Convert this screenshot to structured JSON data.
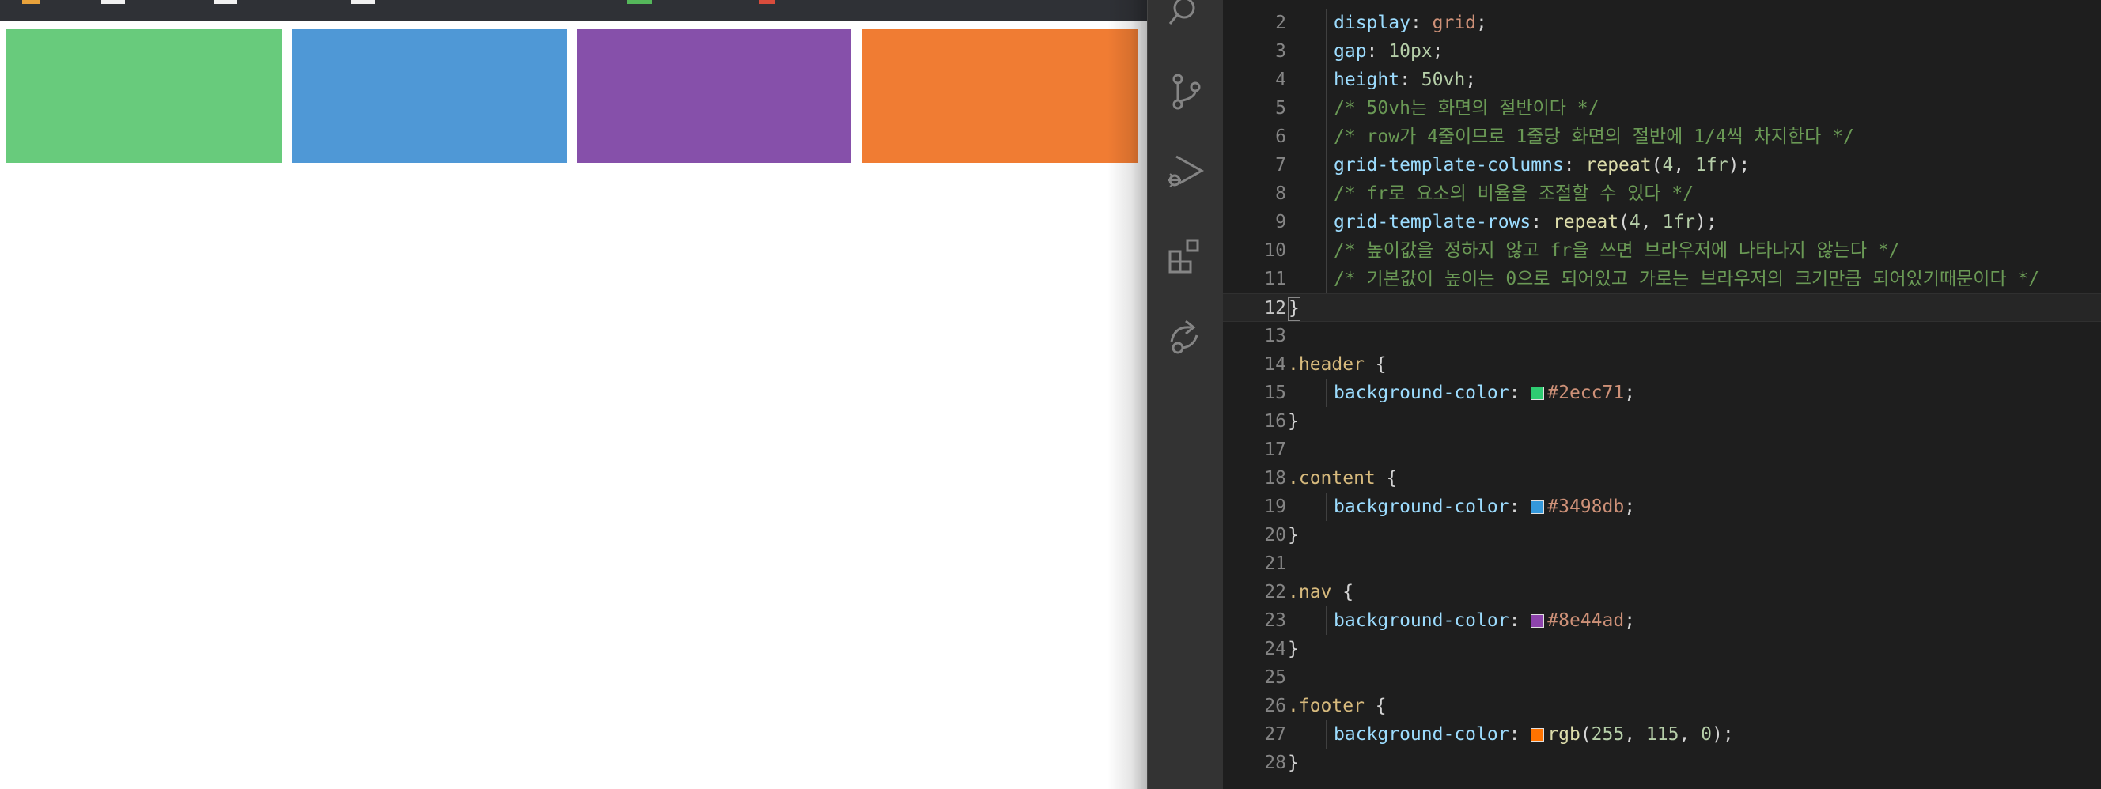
{
  "browser": {
    "bookmark_colors": [
      "#e8a23b",
      "#f1f1f1",
      "#f1f1f1",
      "#f1f1f1",
      "#55b75b",
      "#d94c3c"
    ],
    "grid_boxes": [
      {
        "name": "header",
        "color": "#68cb7c"
      },
      {
        "name": "content",
        "color": "#4f98d6"
      },
      {
        "name": "nav",
        "color": "#8650aa"
      },
      {
        "name": "footer",
        "color": "#f07c33"
      }
    ]
  },
  "activity_bar": {
    "icons": [
      "search-icon",
      "source-control-icon",
      "run-debug-icon",
      "extensions-icon",
      "remote-icon"
    ]
  },
  "editor": {
    "lines": [
      {
        "n": "2",
        "tokens": [
          [
            "prop",
            "display"
          ],
          [
            "pun",
            ": "
          ],
          [
            "val",
            "grid"
          ],
          [
            "pun",
            ";"
          ]
        ]
      },
      {
        "n": "3",
        "tokens": [
          [
            "prop",
            "gap"
          ],
          [
            "pun",
            ": "
          ],
          [
            "num",
            "10px"
          ],
          [
            "pun",
            ";"
          ]
        ]
      },
      {
        "n": "4",
        "tokens": [
          [
            "prop",
            "height"
          ],
          [
            "pun",
            ": "
          ],
          [
            "num",
            "50vh"
          ],
          [
            "pun",
            ";"
          ]
        ]
      },
      {
        "n": "5",
        "tokens": [
          [
            "cm",
            "/* 50vh는 화면의 절반이다 */"
          ]
        ]
      },
      {
        "n": "6",
        "tokens": [
          [
            "cm",
            "/* row가 4줄이므로 1줄당 화면의 절반에 1/4씩 차지한다 */"
          ]
        ]
      },
      {
        "n": "7",
        "tokens": [
          [
            "prop",
            "grid-template-columns"
          ],
          [
            "pun",
            ": "
          ],
          [
            "fn",
            "repeat"
          ],
          [
            "pun",
            "("
          ],
          [
            "num",
            "4"
          ],
          [
            "pun",
            ", "
          ],
          [
            "num",
            "1fr"
          ],
          [
            "pun",
            ");"
          ]
        ]
      },
      {
        "n": "8",
        "tokens": [
          [
            "cm",
            "/* fr로 요소의 비율을 조절할 수 있다 */"
          ]
        ]
      },
      {
        "n": "9",
        "tokens": [
          [
            "prop",
            "grid-template-rows"
          ],
          [
            "pun",
            ": "
          ],
          [
            "fn",
            "repeat"
          ],
          [
            "pun",
            "("
          ],
          [
            "num",
            "4"
          ],
          [
            "pun",
            ", "
          ],
          [
            "num",
            "1fr"
          ],
          [
            "pun",
            ");"
          ]
        ]
      },
      {
        "n": "10",
        "tokens": [
          [
            "cm",
            "/* 높이값을 정하지 않고 fr을 쓰면 브라우저에 나타나지 않는다 */"
          ]
        ]
      },
      {
        "n": "11",
        "tokens": [
          [
            "cm",
            "/* 기본값이 높이는 0으로 되어있고 가로는 브라우저의 크기만큼 되어있기때문이다 */"
          ]
        ]
      },
      {
        "n": "12",
        "tokens": [
          [
            "pun",
            "}"
          ]
        ],
        "current": true,
        "outdent": true
      },
      {
        "n": "13",
        "tokens": [],
        "outdent": true
      },
      {
        "n": "14",
        "tokens": [
          [
            "sel",
            ".header"
          ],
          [
            "pun",
            " {"
          ]
        ],
        "outdent": true
      },
      {
        "n": "15",
        "tokens": [
          [
            "prop",
            "background-color"
          ],
          [
            "pun",
            ": "
          ],
          [
            "swatch",
            "#2ecc71"
          ],
          [
            "val",
            "#2ecc71"
          ],
          [
            "pun",
            ";"
          ]
        ]
      },
      {
        "n": "16",
        "tokens": [
          [
            "pun",
            "}"
          ]
        ],
        "outdent": true
      },
      {
        "n": "17",
        "tokens": [],
        "outdent": true
      },
      {
        "n": "18",
        "tokens": [
          [
            "sel",
            ".content"
          ],
          [
            "pun",
            " {"
          ]
        ],
        "outdent": true
      },
      {
        "n": "19",
        "tokens": [
          [
            "prop",
            "background-color"
          ],
          [
            "pun",
            ": "
          ],
          [
            "swatch",
            "#3498db"
          ],
          [
            "val",
            "#3498db"
          ],
          [
            "pun",
            ";"
          ]
        ]
      },
      {
        "n": "20",
        "tokens": [
          [
            "pun",
            "}"
          ]
        ],
        "outdent": true
      },
      {
        "n": "21",
        "tokens": [],
        "outdent": true
      },
      {
        "n": "22",
        "tokens": [
          [
            "sel",
            ".nav"
          ],
          [
            "pun",
            " {"
          ]
        ],
        "outdent": true
      },
      {
        "n": "23",
        "tokens": [
          [
            "prop",
            "background-color"
          ],
          [
            "pun",
            ": "
          ],
          [
            "swatch",
            "#8e44ad"
          ],
          [
            "val",
            "#8e44ad"
          ],
          [
            "pun",
            ";"
          ]
        ]
      },
      {
        "n": "24",
        "tokens": [
          [
            "pun",
            "}"
          ]
        ],
        "outdent": true
      },
      {
        "n": "25",
        "tokens": [],
        "outdent": true
      },
      {
        "n": "26",
        "tokens": [
          [
            "sel",
            ".footer"
          ],
          [
            "pun",
            " {"
          ]
        ],
        "outdent": true
      },
      {
        "n": "27",
        "tokens": [
          [
            "prop",
            "background-color"
          ],
          [
            "pun",
            ": "
          ],
          [
            "swatch",
            "rgb(255, 115, 0)"
          ],
          [
            "fn",
            "rgb"
          ],
          [
            "pun",
            "("
          ],
          [
            "num",
            "255"
          ],
          [
            "pun",
            ", "
          ],
          [
            "num",
            "115"
          ],
          [
            "pun",
            ", "
          ],
          [
            "num",
            "0"
          ],
          [
            "pun",
            ");"
          ]
        ]
      },
      {
        "n": "28",
        "tokens": [
          [
            "pun",
            "}"
          ]
        ],
        "outdent": true
      }
    ]
  }
}
